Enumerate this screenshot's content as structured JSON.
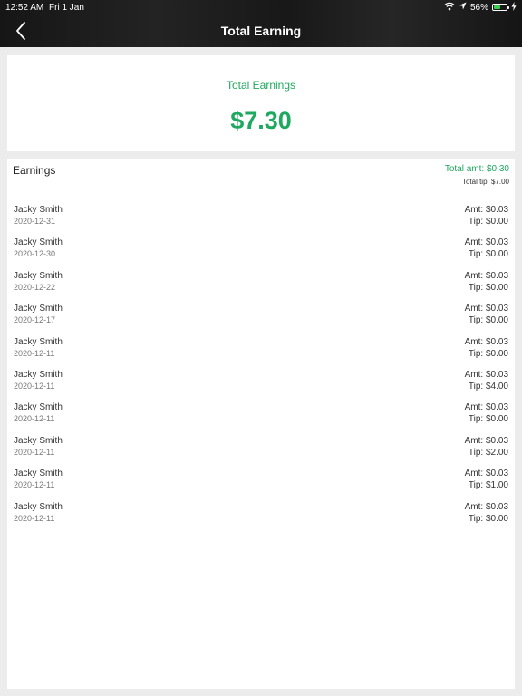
{
  "status_bar": {
    "time": "12:52 AM",
    "date": "Fri 1 Jan",
    "battery": "56%",
    "battery_level": 0.56,
    "icons": [
      "wifi-icon",
      "location-arrow-icon",
      "battery-icon",
      "charging-bolt-icon"
    ]
  },
  "nav": {
    "title": "Total Earning",
    "back_icon": "chevron-left-icon"
  },
  "summary": {
    "label": "Total Earnings",
    "value": "$7.30"
  },
  "earnings": {
    "title": "Earnings",
    "total_amt": "Total amt: $0.30",
    "total_tip": "Total tip: $7.00",
    "rows": [
      {
        "name": "Jacky Smith",
        "date": "2020-12-31",
        "amt": "Amt: $0.03",
        "tip": "Tip: $0.00"
      },
      {
        "name": "Jacky Smith",
        "date": "2020-12-30",
        "amt": "Amt: $0.03",
        "tip": "Tip: $0.00"
      },
      {
        "name": "Jacky Smith",
        "date": "2020-12-22",
        "amt": "Amt: $0.03",
        "tip": "Tip: $0.00"
      },
      {
        "name": "Jacky Smith",
        "date": "2020-12-17",
        "amt": "Amt: $0.03",
        "tip": "Tip: $0.00"
      },
      {
        "name": "Jacky Smith",
        "date": "2020-12-11",
        "amt": "Amt: $0.03",
        "tip": "Tip: $0.00"
      },
      {
        "name": "Jacky Smith",
        "date": "2020-12-11",
        "amt": "Amt: $0.03",
        "tip": "Tip: $4.00"
      },
      {
        "name": "Jacky Smith",
        "date": "2020-12-11",
        "amt": "Amt: $0.03",
        "tip": "Tip: $0.00"
      },
      {
        "name": "Jacky Smith",
        "date": "2020-12-11",
        "amt": "Amt: $0.03",
        "tip": "Tip: $2.00"
      },
      {
        "name": "Jacky Smith",
        "date": "2020-12-11",
        "amt": "Amt: $0.03",
        "tip": "Tip: $1.00"
      },
      {
        "name": "Jacky Smith",
        "date": "2020-12-11",
        "amt": "Amt: $0.03",
        "tip": "Tip: $0.00"
      }
    ]
  },
  "colors": {
    "accent": "#1fa85f",
    "nav_bg": "#1b1b1b",
    "page_bg": "#ececec"
  }
}
